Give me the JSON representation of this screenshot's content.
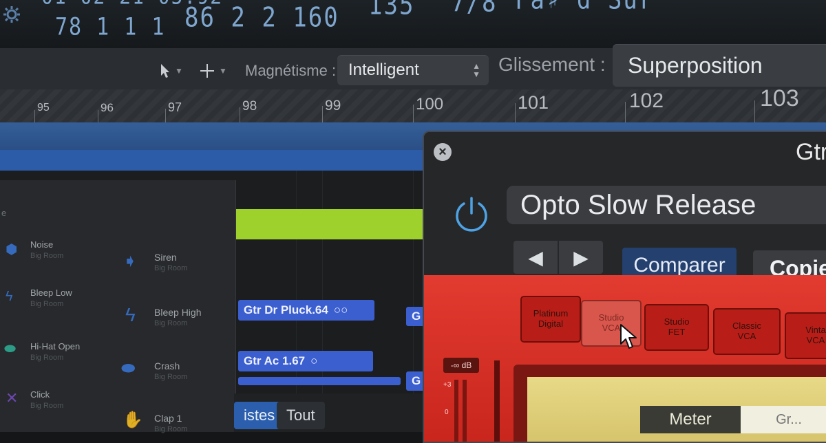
{
  "lcd": {
    "position_top": "01-02-21-05.92",
    "bar_beat": "78 1 1     1",
    "position_values": "86 2 2 160",
    "tempo": "135",
    "time_sig": "7/8",
    "key": "Fa♯ d Sur"
  },
  "toolbar": {
    "pointer_tool": "pointer-icon",
    "marquee_tool": "crosshair-icon",
    "snap_label": "Magnétisme :",
    "snap_value": "Intelligent",
    "drag_label": "Glissement :",
    "drag_value": "Superposition"
  },
  "ruler": {
    "bars": [
      "95",
      "96",
      "97",
      "98",
      "99",
      "100",
      "101",
      "102",
      "103"
    ]
  },
  "regions": [
    {
      "label": "Gtr Dr Pluck.64",
      "icon": "○○"
    },
    {
      "label": "Gtr Ac 1.67",
      "icon": "○"
    },
    {
      "label": "G",
      "icon": ""
    },
    {
      "label": "G",
      "icon": ""
    }
  ],
  "library": {
    "header": "e",
    "items": [
      {
        "name": "Noise",
        "sub": "Big Room"
      },
      {
        "name": "Siren",
        "sub": "Big Room"
      },
      {
        "name": "Bleep Low",
        "sub": "Big Room"
      },
      {
        "name": "Bleep High",
        "sub": "Big Room"
      },
      {
        "name": "Hi-Hat Open",
        "sub": "Big Room"
      },
      {
        "name": "Crash",
        "sub": "Big Room"
      },
      {
        "name": "Click",
        "sub": "Big Room"
      },
      {
        "name": "Clap 1",
        "sub": "Big Room"
      }
    ]
  },
  "bottom_tabs": {
    "tab1": "istes",
    "tab2": "Tout"
  },
  "plugin": {
    "title": "Gtr",
    "preset": "Opto Slow Release",
    "compare": "Comparer",
    "copy": "Copie",
    "models": [
      {
        "label": "Platinum\nDigital",
        "selected": false
      },
      {
        "label": "Studio\nVCA",
        "selected": true
      },
      {
        "label": "Studio\nFET",
        "selected": false
      },
      {
        "label": "Classic\nVCA",
        "selected": false
      },
      {
        "label": "Vinta\nVCA",
        "selected": false
      }
    ],
    "db_label": "-∞ dB",
    "meter_plus3": "+3",
    "meter_zero": "0",
    "meter_tab": "Meter",
    "meter_tab2": "Gr..."
  },
  "colors": {
    "lcd_text": "#7fa6cf",
    "cycle_blue": "#2c5ca8",
    "region_blue": "#3b5fcf",
    "region_green": "#9fd12c",
    "plugin_red": "#d6291f",
    "compare_blue": "#24406e",
    "power_blue": "#4ea3e6"
  }
}
